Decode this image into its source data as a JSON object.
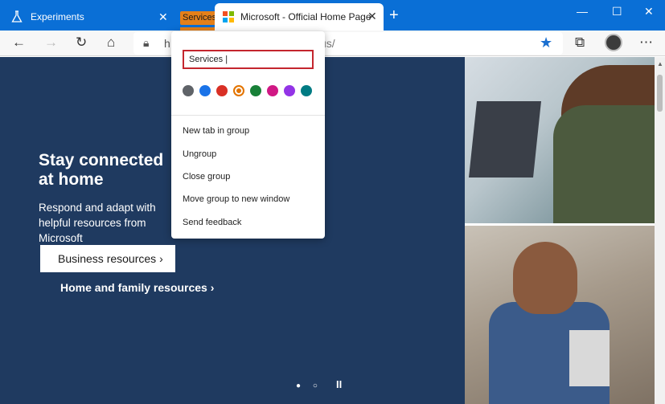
{
  "tabs": {
    "experiments": {
      "label": "Experiments",
      "close": "✕"
    },
    "group_label": "Services",
    "active": {
      "label": "Microsoft - Official Home Page",
      "close": "✕"
    },
    "new_tab": "+"
  },
  "window_controls": {
    "minimize": "—",
    "maximize": "☐",
    "close": "✕"
  },
  "toolbar": {
    "back": "←",
    "forward": "→",
    "refresh": "↻",
    "home": "⌂",
    "url_start": "h",
    "url_end": "us/",
    "favorite": "★",
    "collections": "⧉",
    "more": "⋯"
  },
  "popup": {
    "input_value": "Services |",
    "colors": [
      "#5f6368",
      "#1a73e8",
      "#d93025",
      "#e37400",
      "#188038",
      "#d01884",
      "#9334e6",
      "#007b83"
    ],
    "selected_color_index": 3,
    "menu_items": [
      "New tab in group",
      "Ungroup",
      "Close group",
      "Move group to new window",
      "Send feedback"
    ]
  },
  "hero": {
    "heading": "Stay connected at home",
    "description": "Respond and adapt with helpful resources from Microsoft",
    "business_button": "Business resources",
    "home_link": "Home and family resources"
  },
  "carousel": {
    "dots": "● ○",
    "pause": "II"
  }
}
